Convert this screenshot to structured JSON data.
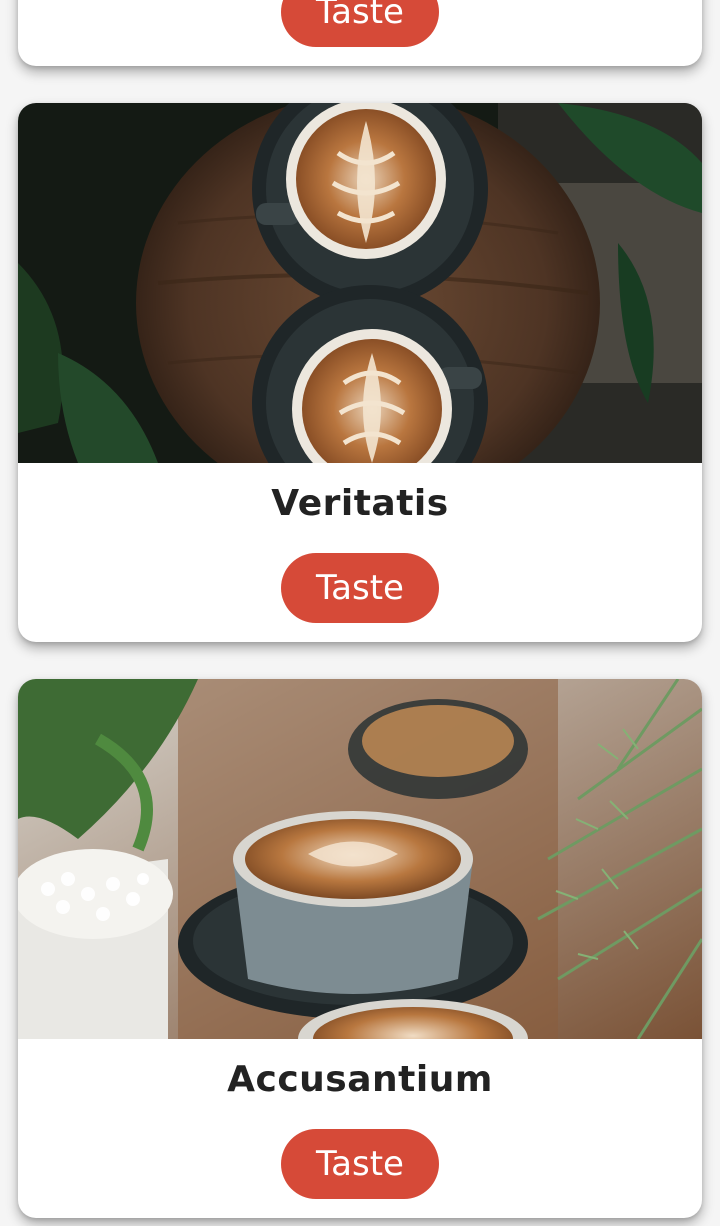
{
  "theme": {
    "button_color": "#d64a38",
    "card_background": "#ffffff",
    "page_background": "#f5f5f5"
  },
  "cards": [
    {
      "title": "",
      "button_label": "Taste",
      "image": "coffee-photo"
    },
    {
      "title": "Veritatis",
      "button_label": "Taste",
      "image": "latte-art-two-cups-on-wooden-table-photo"
    },
    {
      "title": "Accusantium",
      "button_label": "Taste",
      "image": "latte-cups-with-plants-photo"
    }
  ]
}
